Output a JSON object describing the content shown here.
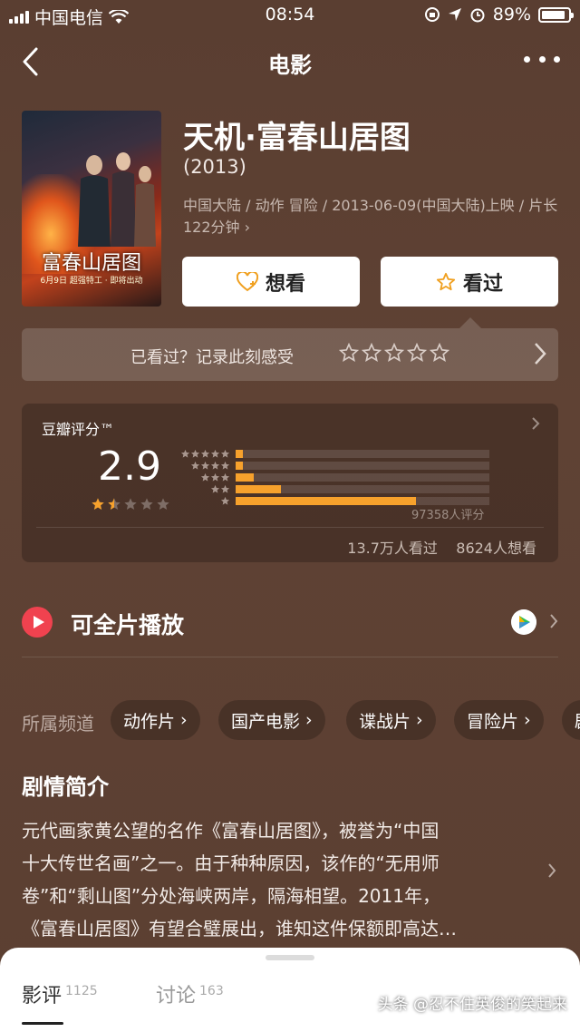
{
  "status_bar": {
    "carrier": "中国电信",
    "time": "08:54",
    "battery": "89%",
    "battery_level": 0.89
  },
  "nav": {
    "title": "电影"
  },
  "poster": {
    "title_text": "富春山居图",
    "sub_text": "6月9日 超强特工 · 即将出动"
  },
  "movie": {
    "title": "天机·富春山居图",
    "year": "(2013)",
    "meta": "中国大陆 / 动作 冒险 / 2013-06-09(中国大陆)上映 / 片长122分钟 ›"
  },
  "buttons": {
    "want": "想看",
    "seen": "看过"
  },
  "record": {
    "prompt": "已看过？记录此刻感受"
  },
  "rating": {
    "label": "豆瓣评分™",
    "score": "2.9",
    "score_stars": 1.5,
    "distribution": [
      {
        "stars": 5,
        "fraction": 0.03
      },
      {
        "stars": 4,
        "fraction": 0.03
      },
      {
        "stars": 3,
        "fraction": 0.07
      },
      {
        "stars": 2,
        "fraction": 0.18
      },
      {
        "stars": 1,
        "fraction": 0.71
      }
    ],
    "count": "97358人评分",
    "watched": "13.7万人看过",
    "want": "8624人想看"
  },
  "play": {
    "label": "可全片播放"
  },
  "channels": {
    "label": "所属频道",
    "items": [
      "动作片",
      "国产电影",
      "谍战片",
      "冒险片",
      "剧"
    ]
  },
  "synopsis": {
    "title": "剧情简介",
    "lines": [
      "元代画家黄公望的名作《富春山居图》，被誉为“中国",
      "十大传世名画”之一。由于种种原因，该作的“无用师",
      "卷”和“剩山图”分处海峡两岸，隔海相望。2011年，",
      "《富春山居图》有望合璧展出，谁知这件保额即高达…"
    ]
  },
  "sheet": {
    "tab_reviews": "影评",
    "reviews_count": "1125",
    "tab_discuss": "讨论",
    "discuss_count": "163"
  },
  "watermark": "头条 @忍不住英俊的笑起来",
  "colors": {
    "accent": "#f7a12c",
    "play": "#f0424f",
    "background": "#5c4033"
  }
}
